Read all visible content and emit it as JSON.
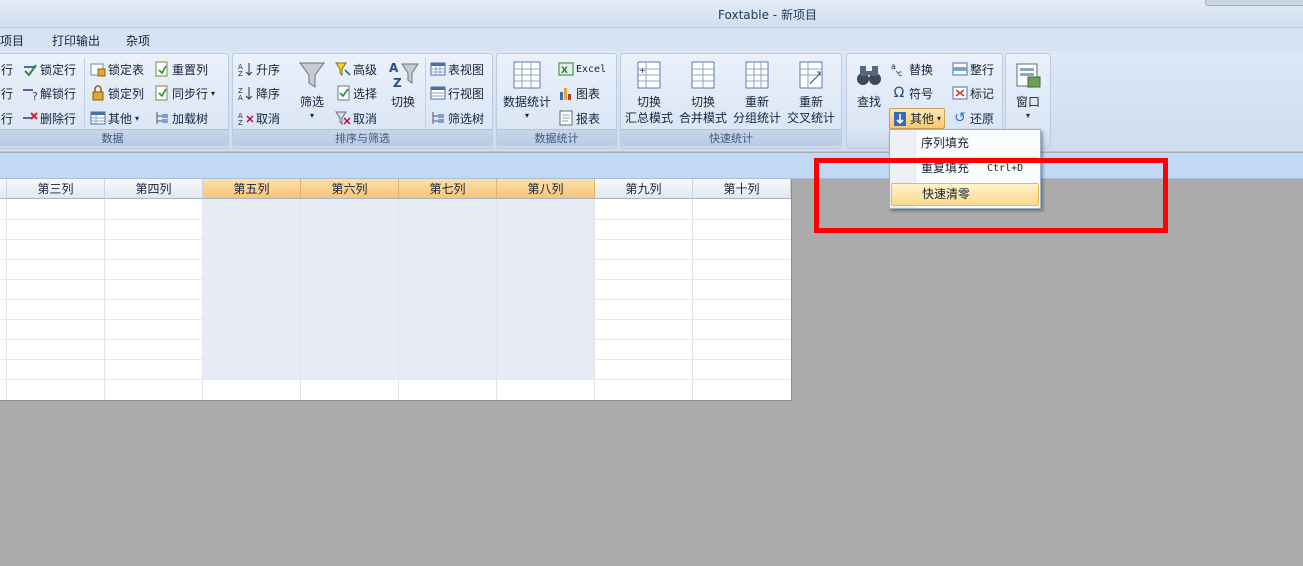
{
  "window": {
    "title": "Foxtable - 新项目"
  },
  "menu": {
    "tabs": [
      "项目",
      "打印输出",
      "杂项"
    ]
  },
  "ribbon": {
    "group_data": {
      "label": "数据",
      "items": [
        "行",
        "行",
        "行",
        "锁定行",
        "解锁行",
        "删除行",
        "锁定表",
        "锁定列",
        "其他",
        "重置列",
        "同步行",
        "加载树"
      ]
    },
    "group_sort": {
      "label": "排序与筛选",
      "items": [
        "升序",
        "降序",
        "取消",
        "筛选",
        "高级",
        "选择",
        "取消",
        "切换",
        "表视图",
        "行视图",
        "筛选树"
      ]
    },
    "group_stats": {
      "label": "数据统计",
      "items": [
        "数据统计",
        "Excel",
        "图表",
        "报表"
      ]
    },
    "group_quick": {
      "label": "快速统计",
      "buttons": [
        {
          "l1": "切换",
          "l2": "汇总模式"
        },
        {
          "l1": "切换",
          "l2": "合并模式"
        },
        {
          "l1": "重新",
          "l2": "分组统计"
        },
        {
          "l1": "重新",
          "l2": "交叉统计"
        }
      ]
    },
    "group_edit": {
      "items": [
        "查找",
        "替换",
        "符号",
        "其他",
        "整行",
        "标记",
        "还原"
      ]
    },
    "group_window": {
      "items": [
        "窗口"
      ]
    }
  },
  "grid": {
    "columns": [
      "第三列",
      "第四列",
      "第五列",
      "第六列",
      "第七列",
      "第八列",
      "第九列",
      "第十列"
    ],
    "selected_columns": [
      "第五列",
      "第六列",
      "第七列",
      "第八列"
    ]
  },
  "dropdown": {
    "items": [
      {
        "label": "序列填充",
        "shortcut": ""
      },
      {
        "label": "重复填充",
        "shortcut": "Ctrl+D"
      },
      {
        "label": "快速清零",
        "shortcut": ""
      }
    ],
    "highlighted": "快速清零"
  },
  "colors": {
    "selected_header": "#f8c47a",
    "selected_column": "#e8eaf5",
    "annotation_box": "#ff0000",
    "ribbon": "#dbe6f4",
    "workspace": "#ababab"
  }
}
